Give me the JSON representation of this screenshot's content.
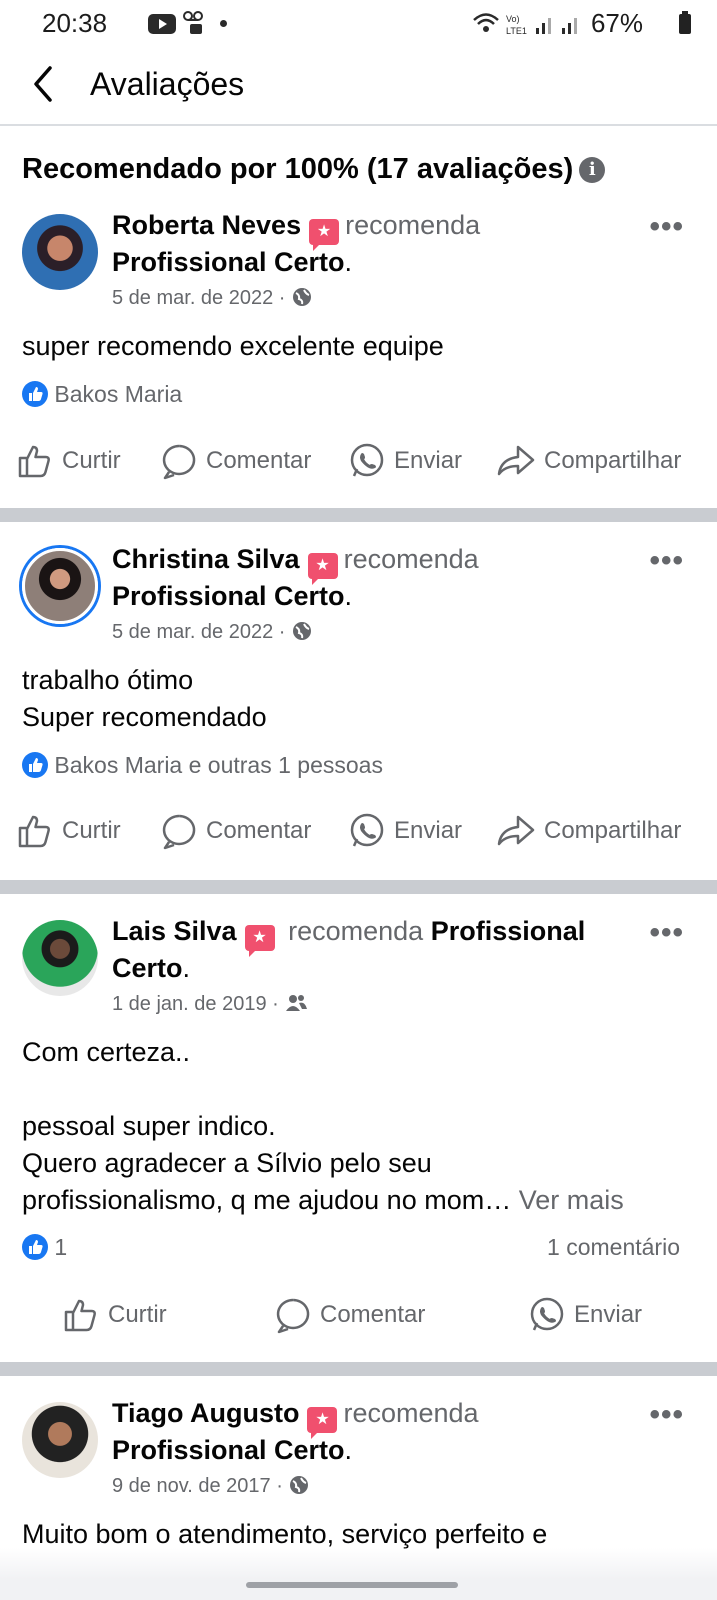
{
  "status_bar": {
    "time": "20:38",
    "battery": "67%"
  },
  "header": {
    "title": "Avaliações"
  },
  "summary": {
    "text": "Recomendado por 100% (17 avaliações)"
  },
  "actions": {
    "like": "Curtir",
    "comment": "Comentar",
    "send": "Enviar",
    "share": "Compartilhar"
  },
  "posts": [
    {
      "author": "Roberta Neves",
      "verb": "recomenda",
      "page": "Profissional Certo",
      "period": ".",
      "date": "5 de mar. de 2022",
      "privacy_icon": "globe-icon",
      "text_lines": [
        "super recomendo excelente equipe"
      ],
      "reactions": "Bakos Maria"
    },
    {
      "author": "Christina Silva",
      "verb": "recomenda",
      "page": "Profissional Certo",
      "period": ".",
      "date": "5 de mar. de 2022",
      "privacy_icon": "globe-icon",
      "text_lines": [
        "trabalho ótimo",
        "Super recomendado"
      ],
      "reactions": "Bakos Maria e outras 1 pessoas"
    },
    {
      "author": "Lais Silva",
      "verb": "recomenda",
      "page_part1": "Profissional",
      "page_part2": "Certo",
      "period": ".",
      "date": "1 de jan. de 2019",
      "privacy_icon": "friends-icon",
      "text_lines": [
        "Com certeza..",
        "",
        "pessoal super indico.",
        "Quero agradecer a Sílvio pelo seu"
      ],
      "text_last": "profissionalismo, q me ajudou no mom…",
      "see_more": "Ver mais",
      "reactions": "1",
      "comments": "1 comentário"
    },
    {
      "author": "Tiago Augusto",
      "verb": "recomenda",
      "page": "Profissional Certo",
      "period": ".",
      "date": "9 de nov. de 2017",
      "privacy_icon": "globe-icon",
      "text_lines": [
        "Muito bom o atendimento, serviço perfeito e"
      ]
    }
  ]
}
